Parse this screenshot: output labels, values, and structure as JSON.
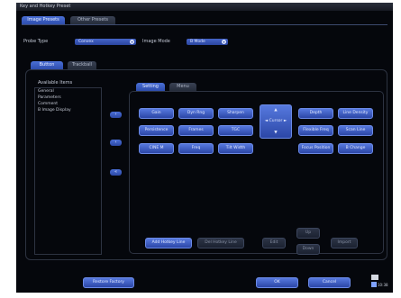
{
  "window": {
    "title": "Key and Hotkey Preset"
  },
  "top_tabs": [
    "Image Presets",
    "Other Presets"
  ],
  "probe": {
    "label": "Probe Type",
    "value": "Convex"
  },
  "image_mode": {
    "label": "Image Mode",
    "value": "B Mode"
  },
  "sub_tabs": [
    "Button",
    "Trackball"
  ],
  "available_items": {
    "heading": "Available Items",
    "items": [
      "General",
      "Parameters",
      "Comment",
      "B Image Display"
    ]
  },
  "arrows": {
    "right": "›",
    "left": "‹",
    "remove_all": "«"
  },
  "inner_tabs": [
    "Setting",
    "Menu"
  ],
  "keys": [
    [
      "Gain",
      "Dyn Rng",
      "Sharpen",
      "",
      "Depth",
      "Line Density"
    ],
    [
      "Persistence",
      "Frames",
      "TGC",
      "",
      "Flexible Freq",
      "Scan Line"
    ],
    [
      "CINE M",
      "Freq",
      "Tilt Width",
      "",
      "Focus Position",
      "B Change"
    ]
  ],
  "dpad": {
    "up": "▲",
    "center": "◄ Cursor ►",
    "down": "▼"
  },
  "action_buttons": {
    "add_hotkey": "Add Hotkey Line",
    "del_hotkey": "Del Hotkey Line",
    "edit": "Edit",
    "up": "Up",
    "down": "Down",
    "import": "Import"
  },
  "footer": {
    "restore": "Restore Factory",
    "ok": "OK",
    "cancel": "Cancel",
    "time": "10:38"
  }
}
